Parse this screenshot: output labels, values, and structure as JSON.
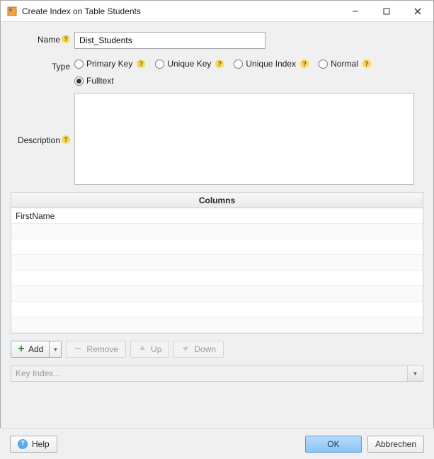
{
  "window": {
    "title": "Create Index on Table Students"
  },
  "form": {
    "name_label": "Name",
    "name_value": "Dist_Students",
    "type_label": "Type",
    "type_options": {
      "primary_key": "Primary Key",
      "unique_key": "Unique Key",
      "unique_index": "Unique Index",
      "normal": "Normal",
      "fulltext": "Fulltext"
    },
    "type_selected": "fulltext",
    "description_label": "Description",
    "description_value": ""
  },
  "columns": {
    "header": "Columns",
    "rows": [
      "FirstName",
      "",
      "",
      "",
      "",
      "",
      "",
      ""
    ]
  },
  "toolbar": {
    "add_label": "Add",
    "remove_label": "Remove",
    "up_label": "Up",
    "down_label": "Down"
  },
  "key_index": {
    "placeholder": "Key Index..."
  },
  "footer": {
    "help_label": "Help",
    "ok_label": "OK",
    "cancel_label": "Abbrechen"
  }
}
